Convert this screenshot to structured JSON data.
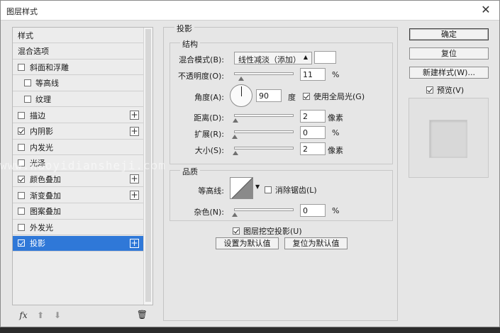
{
  "window": {
    "title": "图层样式"
  },
  "style_list": {
    "items": [
      {
        "label": "样式",
        "has_checkbox": false,
        "checked": false,
        "has_plus": false,
        "selected": false
      },
      {
        "label": "混合选项",
        "has_checkbox": false,
        "checked": false,
        "has_plus": false,
        "selected": false
      },
      {
        "label": "斜面和浮雕",
        "has_checkbox": true,
        "checked": false,
        "has_plus": false,
        "selected": false
      },
      {
        "label": "等高线",
        "has_checkbox": true,
        "checked": false,
        "has_plus": false,
        "selected": false,
        "sub": true
      },
      {
        "label": "纹理",
        "has_checkbox": true,
        "checked": false,
        "has_plus": false,
        "selected": false,
        "sub": true
      },
      {
        "label": "描边",
        "has_checkbox": true,
        "checked": false,
        "has_plus": true,
        "selected": false
      },
      {
        "label": "内阴影",
        "has_checkbox": true,
        "checked": true,
        "has_plus": true,
        "selected": false
      },
      {
        "label": "内发光",
        "has_checkbox": true,
        "checked": false,
        "has_plus": false,
        "selected": false
      },
      {
        "label": "光泽",
        "has_checkbox": true,
        "checked": false,
        "has_plus": false,
        "selected": false
      },
      {
        "label": "颜色叠加",
        "has_checkbox": true,
        "checked": true,
        "has_plus": true,
        "selected": false
      },
      {
        "label": "渐变叠加",
        "has_checkbox": true,
        "checked": false,
        "has_plus": true,
        "selected": false
      },
      {
        "label": "图案叠加",
        "has_checkbox": true,
        "checked": false,
        "has_plus": false,
        "selected": false
      },
      {
        "label": "外发光",
        "has_checkbox": true,
        "checked": false,
        "has_plus": false,
        "selected": false
      },
      {
        "label": "投影",
        "has_checkbox": true,
        "checked": true,
        "has_plus": true,
        "selected": true
      }
    ],
    "footer": {
      "fx_label": "fx",
      "up_icon": "arrow-up-icon",
      "down_icon": "arrow-down-icon",
      "trash_icon": "trash-icon"
    }
  },
  "drop_shadow": {
    "section_title": "投影",
    "structure": {
      "title": "结构",
      "blend_mode_label": "混合模式(B):",
      "blend_mode_value": "线性减淡（添加）",
      "opacity_label": "不透明度(O):",
      "opacity_value": "11",
      "opacity_unit": "%",
      "opacity_fraction": 0.11,
      "angle_label": "角度(A):",
      "angle_value": "90",
      "angle_unit": "度",
      "global_light_label": "使用全局光(G)",
      "global_light_checked": true,
      "distance_label": "距离(D):",
      "distance_value": "2",
      "distance_unit": "像素",
      "spread_label": "扩展(R):",
      "spread_value": "0",
      "spread_unit": "%",
      "size_label": "大小(S):",
      "size_value": "2",
      "size_unit": "像素"
    },
    "quality": {
      "title": "品质",
      "contour_label": "等高线:",
      "antialias_label": "消除锯齿(L)",
      "antialias_checked": false,
      "noise_label": "杂色(N):",
      "noise_value": "0",
      "noise_unit": "%"
    },
    "knockout_label": "图层挖空投影(U)",
    "knockout_checked": true,
    "make_default_label": "设置为默认值",
    "reset_default_label": "复位为默认值"
  },
  "actions": {
    "ok_label": "确定",
    "reset_label": "复位",
    "new_style_label": "新建样式(W)...",
    "preview_label": "预览(V)",
    "preview_checked": true
  },
  "watermark": "www.haoyidiansheji.com",
  "colors": {
    "selection": "#2f78d8",
    "dialog_bg": "#e6e6e6"
  }
}
